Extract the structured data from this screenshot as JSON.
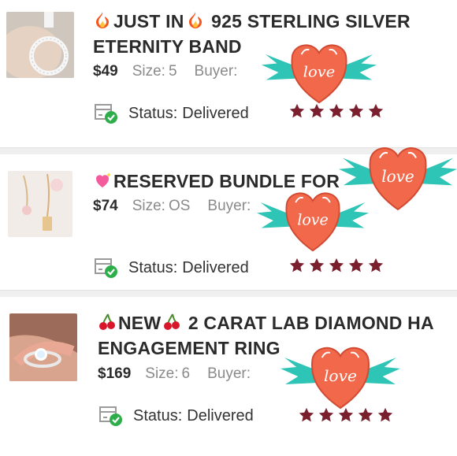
{
  "orders": [
    {
      "title_text": "JUST IN",
      "title_rest": " 925 STERLING SILVER",
      "title_line2": "ETERNITY BAND",
      "price": "$49",
      "size_label": "Size:",
      "size_value": "5",
      "buyer_label": "Buyer:",
      "status_label": "Status:",
      "status_value": "Delivered",
      "rating": 5
    },
    {
      "title_text": "RESERVED BUNDLE FOR",
      "price": "$74",
      "size_label": "Size:",
      "size_value": "OS",
      "buyer_label": "Buyer:",
      "status_label": "Status:",
      "status_value": "Delivered",
      "rating": 5
    },
    {
      "title_text": "NEW",
      "title_rest": " 2 CARAT LAB DIAMOND HA",
      "title_line2": "ENGAGEMENT RING",
      "price": "$169",
      "size_label": "Size:",
      "size_value": "6",
      "buyer_label": "Buyer:",
      "status_label": "Status:",
      "status_value": "Delivered",
      "rating": 5
    }
  ],
  "sticker": {
    "text": "love"
  },
  "colors": {
    "star": "#7a1f2e",
    "heart": "#f2684b",
    "wing": "#2ec4b6",
    "check": "#2eae4a"
  }
}
